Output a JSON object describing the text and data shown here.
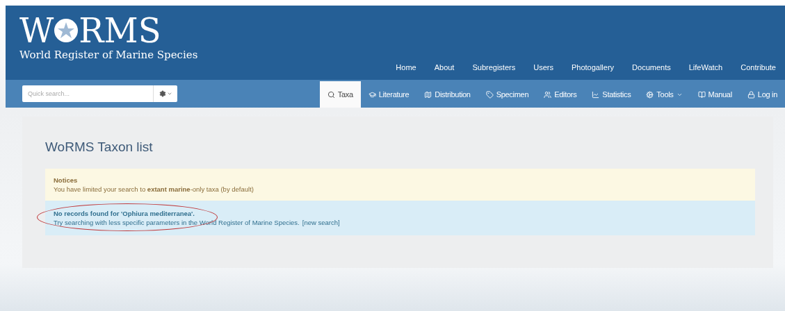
{
  "logo": {
    "letter_start": "W",
    "letter_end": "RMS",
    "subtitle": "World Register of Marine Species"
  },
  "top_nav": [
    "Home",
    "About",
    "Subregisters",
    "Users",
    "Photogallery",
    "Documents",
    "LifeWatch",
    "Contribute"
  ],
  "search": {
    "placeholder": "Quick search..."
  },
  "tabs": [
    {
      "label": "Taxa",
      "selected": true,
      "dropdown": false
    },
    {
      "label": "Literature",
      "selected": false,
      "dropdown": false
    },
    {
      "label": "Distribution",
      "selected": false,
      "dropdown": false
    },
    {
      "label": "Specimen",
      "selected": false,
      "dropdown": false
    },
    {
      "label": "Editors",
      "selected": false,
      "dropdown": false
    },
    {
      "label": "Statistics",
      "selected": false,
      "dropdown": false
    },
    {
      "label": "Tools",
      "selected": false,
      "dropdown": true
    },
    {
      "label": "Manual",
      "selected": false,
      "dropdown": false
    },
    {
      "label": "Log in",
      "selected": false,
      "dropdown": false
    }
  ],
  "page_title": "WoRMS Taxon list",
  "notice": {
    "title": "Notices",
    "text": "You have limited your search to **extant marine**-only taxa (by default)"
  },
  "result": {
    "title": "No records found for 'Ophiura mediterranea'.",
    "text": "Try searching with less specific parameters in the World Register of Marine Species.",
    "link": "[new search]",
    "highlighted": true
  }
}
